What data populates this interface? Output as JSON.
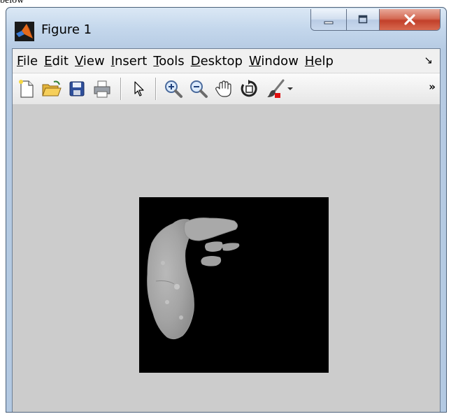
{
  "page": {
    "cut_text": "below"
  },
  "window": {
    "title": "Figure 1",
    "menu": [
      {
        "accel": "F",
        "rest": "ile"
      },
      {
        "accel": "E",
        "rest": "dit"
      },
      {
        "accel": "V",
        "rest": "iew"
      },
      {
        "accel": "I",
        "rest": "nsert"
      },
      {
        "accel": "T",
        "rest": "ools"
      },
      {
        "accel": "D",
        "rest": "esktop"
      },
      {
        "accel": "W",
        "rest": "indow"
      },
      {
        "accel": "H",
        "rest": "elp"
      }
    ],
    "menu_more_glyph": "↘",
    "toolbar_more_glyph": "»",
    "toolbar_buttons": [
      "new-figure",
      "open-file",
      "save",
      "print",
      "edit-plot",
      "zoom-in",
      "zoom-out",
      "pan",
      "rotate-3d",
      "data-brushing"
    ]
  },
  "colors": {
    "figure_background": "#cccccc",
    "axes_background": "#000000",
    "close_button": "#c2402a"
  }
}
